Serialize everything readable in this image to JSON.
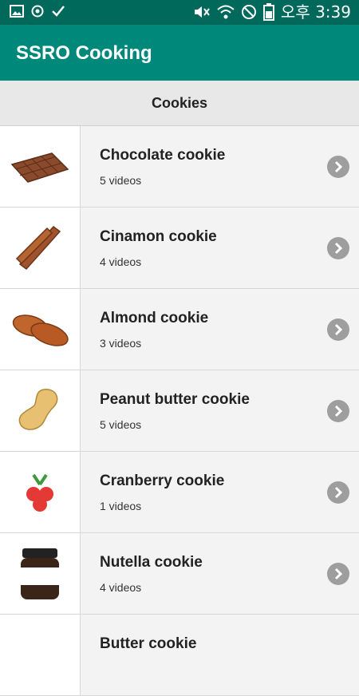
{
  "status_bar": {
    "time": "오후 3:39"
  },
  "app": {
    "title": "SSRO Cooking"
  },
  "section": {
    "title": "Cookies"
  },
  "items": [
    {
      "title": "Chocolate cookie",
      "subtitle": "5 videos",
      "icon": "chocolate-bar-icon"
    },
    {
      "title": "Cinamon cookie",
      "subtitle": "4 videos",
      "icon": "cinnamon-sticks-icon"
    },
    {
      "title": "Almond cookie",
      "subtitle": "3 videos",
      "icon": "almond-icon"
    },
    {
      "title": "Peanut butter cookie",
      "subtitle": "5 videos",
      "icon": "peanut-icon"
    },
    {
      "title": "Cranberry cookie",
      "subtitle": "1 videos",
      "icon": "cranberry-icon"
    },
    {
      "title": "Nutella cookie",
      "subtitle": "4 videos",
      "icon": "nutella-jar-icon"
    },
    {
      "title": "Butter cookie",
      "subtitle": "",
      "icon": "butter-icon"
    }
  ],
  "colors": {
    "status_bar": "#00695c",
    "app_bar": "#00897b",
    "chevron": "#9e9e9e"
  }
}
